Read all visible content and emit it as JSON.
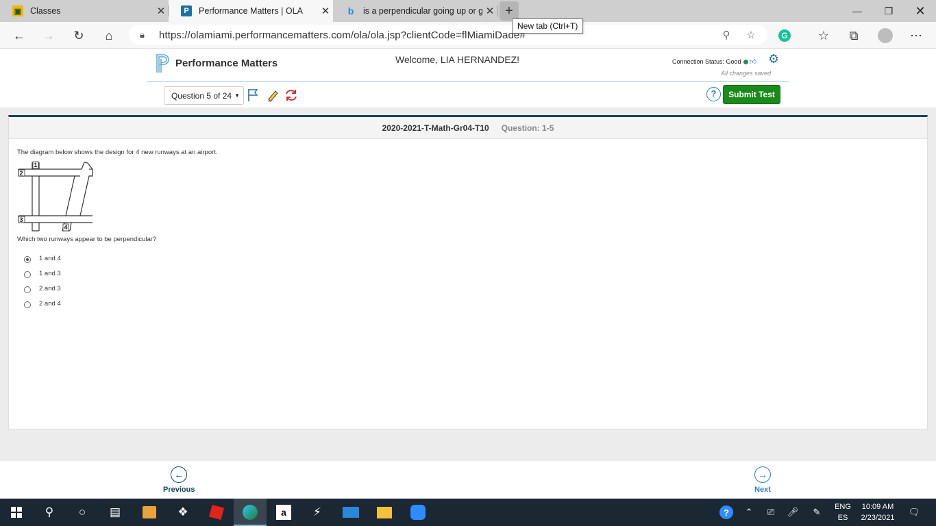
{
  "browser": {
    "tabs": [
      {
        "title": "Classes",
        "favicon": "classroom-icon"
      },
      {
        "title": "Performance Matters | OLA",
        "favicon": "pm-icon"
      },
      {
        "title": "is a perpendicular going up or go",
        "favicon": "bing-icon"
      }
    ],
    "new_tab_tooltip": "New tab (Ctrl+T)",
    "url": "https://olamiami.performancematters.com/ola/ola.jsp?clientCode=flMiamiDade#"
  },
  "app": {
    "brand": "Performance Matters",
    "welcome": "Welcome, LIA HERNANDEZ!",
    "connection_label": "Connection Status: Good",
    "saved_status": "All changes saved",
    "question_selector": "Question 5 of 24",
    "help_label": "?",
    "submit_label": "Submit Test",
    "colors": {
      "submit": "#1a8a1a",
      "header_bar": "#12445e",
      "link": "#2a7ec0"
    }
  },
  "test": {
    "code": "2020-2021-T-Math-Gr04-T10",
    "question_ref": "Question: 1-5",
    "prompt": "The diagram below shows the design for 4 new runways at an airport.",
    "diagram_labels": [
      "1",
      "2",
      "3",
      "4"
    ],
    "question": "Which two runways appear to be perpendicular?",
    "options": [
      {
        "label": "1 and 4",
        "selected": true
      },
      {
        "label": "1 and 3",
        "selected": false
      },
      {
        "label": "2 and 3",
        "selected": false
      },
      {
        "label": "2 and 4",
        "selected": false
      }
    ]
  },
  "footer": {
    "previous": "Previous",
    "next": "Next"
  },
  "taskbar": {
    "lang": "ENG",
    "layout": "ES",
    "time": "10:09 AM",
    "date": "2/23/2021"
  }
}
